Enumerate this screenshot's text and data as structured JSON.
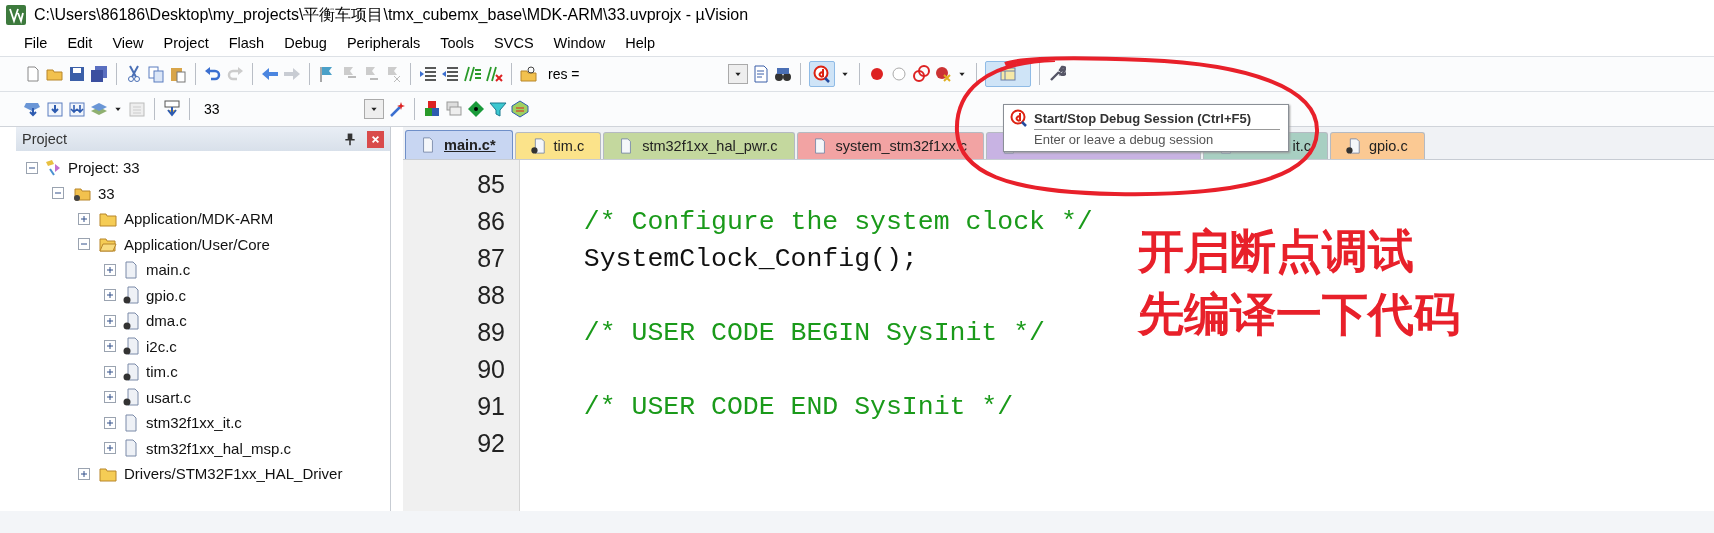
{
  "window": {
    "title": "C:\\Users\\86186\\Desktop\\my_projects\\平衡车项目\\tmx_cubemx_base\\MDK-ARM\\33.uvprojx - µVision"
  },
  "menu": [
    "File",
    "Edit",
    "View",
    "Project",
    "Flash",
    "Debug",
    "Peripherals",
    "Tools",
    "SVCS",
    "Window",
    "Help"
  ],
  "toolbar": {
    "find_field": {
      "value": "res ="
    },
    "target_field": {
      "value": "33"
    },
    "debug_button": {
      "selected": true
    },
    "window_button": {
      "selected": true
    }
  },
  "tooltip": {
    "title": "Start/Stop Debug Session (Ctrl+F5)",
    "description": "Enter or leave a debug session"
  },
  "project_panel": {
    "title": "Project",
    "tree": [
      {
        "label": "Project: 33",
        "kind": "project",
        "expanded": true,
        "children": [
          {
            "label": "33",
            "kind": "target",
            "expanded": true,
            "children": [
              {
                "label": "Application/MDK-ARM",
                "kind": "folder",
                "expanded": false
              },
              {
                "label": "Application/User/Core",
                "kind": "folder",
                "expanded": true,
                "children": [
                  {
                    "label": "main.c",
                    "kind": "file",
                    "expanded": false
                  },
                  {
                    "label": "gpio.c",
                    "kind": "gen_file",
                    "expanded": false
                  },
                  {
                    "label": "dma.c",
                    "kind": "gen_file",
                    "expanded": false
                  },
                  {
                    "label": "i2c.c",
                    "kind": "gen_file",
                    "expanded": false
                  },
                  {
                    "label": "tim.c",
                    "kind": "gen_file",
                    "expanded": false
                  },
                  {
                    "label": "usart.c",
                    "kind": "gen_file",
                    "expanded": false
                  },
                  {
                    "label": "stm32f1xx_it.c",
                    "kind": "file",
                    "expanded": false
                  },
                  {
                    "label": "stm32f1xx_hal_msp.c",
                    "kind": "file",
                    "expanded": false
                  }
                ]
              },
              {
                "label": "Drivers/STM32F1xx_HAL_Driver",
                "kind": "folder",
                "expanded": false
              }
            ]
          }
        ]
      }
    ]
  },
  "tabs": [
    {
      "label": "main.c*",
      "kind": "file",
      "color": "#c8d6f2",
      "selected": true
    },
    {
      "label": "tim.c",
      "kind": "gen_file",
      "color": "#fbe38a",
      "selected": false
    },
    {
      "label": "stm32f1xx_hal_pwr.c",
      "kind": "file",
      "color": "#c4d89e",
      "selected": false
    },
    {
      "label": "system_stm32f1xx.c",
      "kind": "file",
      "color": "#f2a3a3",
      "selected": false
    },
    {
      "kind": "file",
      "color": "#c8b3e3",
      "selected": false
    },
    {
      "label": "it.c",
      "kind": "file",
      "color": "#a8cfc2",
      "selected": false
    },
    {
      "label": "gpio.c",
      "kind": "gen_file",
      "color": "#fbc993",
      "selected": false
    }
  ],
  "code": [
    {
      "number": "85",
      "kind": "code"
    },
    {
      "number": "86",
      "text": "  /* Configure the system clock */",
      "kind": "comment"
    },
    {
      "number": "87",
      "text": "  SystemClock_Config();",
      "kind": "code"
    },
    {
      "number": "88",
      "kind": "code"
    },
    {
      "number": "89",
      "text": "  /* USER CODE BEGIN SysInit */",
      "kind": "comment"
    },
    {
      "number": "90",
      "kind": "code"
    },
    {
      "number": "91",
      "text": "  /* USER CODE END SysInit */",
      "kind": "comment"
    },
    {
      "number": "92",
      "kind": "code"
    }
  ],
  "annotation": {
    "lines": [
      "开启断点调试",
      "先编译一下代码"
    ],
    "color": "#e8202a"
  }
}
